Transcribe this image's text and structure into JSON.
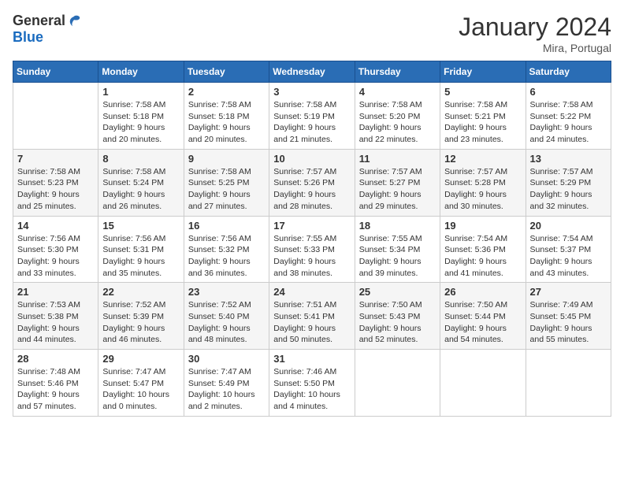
{
  "logo": {
    "general": "General",
    "blue": "Blue"
  },
  "header": {
    "month": "January 2024",
    "location": "Mira, Portugal"
  },
  "weekdays": [
    "Sunday",
    "Monday",
    "Tuesday",
    "Wednesday",
    "Thursday",
    "Friday",
    "Saturday"
  ],
  "weeks": [
    [
      {
        "day": "",
        "info": ""
      },
      {
        "day": "1",
        "info": "Sunrise: 7:58 AM\nSunset: 5:18 PM\nDaylight: 9 hours\nand 20 minutes."
      },
      {
        "day": "2",
        "info": "Sunrise: 7:58 AM\nSunset: 5:18 PM\nDaylight: 9 hours\nand 20 minutes."
      },
      {
        "day": "3",
        "info": "Sunrise: 7:58 AM\nSunset: 5:19 PM\nDaylight: 9 hours\nand 21 minutes."
      },
      {
        "day": "4",
        "info": "Sunrise: 7:58 AM\nSunset: 5:20 PM\nDaylight: 9 hours\nand 22 minutes."
      },
      {
        "day": "5",
        "info": "Sunrise: 7:58 AM\nSunset: 5:21 PM\nDaylight: 9 hours\nand 23 minutes."
      },
      {
        "day": "6",
        "info": "Sunrise: 7:58 AM\nSunset: 5:22 PM\nDaylight: 9 hours\nand 24 minutes."
      }
    ],
    [
      {
        "day": "7",
        "info": "Sunrise: 7:58 AM\nSunset: 5:23 PM\nDaylight: 9 hours\nand 25 minutes."
      },
      {
        "day": "8",
        "info": "Sunrise: 7:58 AM\nSunset: 5:24 PM\nDaylight: 9 hours\nand 26 minutes."
      },
      {
        "day": "9",
        "info": "Sunrise: 7:58 AM\nSunset: 5:25 PM\nDaylight: 9 hours\nand 27 minutes."
      },
      {
        "day": "10",
        "info": "Sunrise: 7:57 AM\nSunset: 5:26 PM\nDaylight: 9 hours\nand 28 minutes."
      },
      {
        "day": "11",
        "info": "Sunrise: 7:57 AM\nSunset: 5:27 PM\nDaylight: 9 hours\nand 29 minutes."
      },
      {
        "day": "12",
        "info": "Sunrise: 7:57 AM\nSunset: 5:28 PM\nDaylight: 9 hours\nand 30 minutes."
      },
      {
        "day": "13",
        "info": "Sunrise: 7:57 AM\nSunset: 5:29 PM\nDaylight: 9 hours\nand 32 minutes."
      }
    ],
    [
      {
        "day": "14",
        "info": "Sunrise: 7:56 AM\nSunset: 5:30 PM\nDaylight: 9 hours\nand 33 minutes."
      },
      {
        "day": "15",
        "info": "Sunrise: 7:56 AM\nSunset: 5:31 PM\nDaylight: 9 hours\nand 35 minutes."
      },
      {
        "day": "16",
        "info": "Sunrise: 7:56 AM\nSunset: 5:32 PM\nDaylight: 9 hours\nand 36 minutes."
      },
      {
        "day": "17",
        "info": "Sunrise: 7:55 AM\nSunset: 5:33 PM\nDaylight: 9 hours\nand 38 minutes."
      },
      {
        "day": "18",
        "info": "Sunrise: 7:55 AM\nSunset: 5:34 PM\nDaylight: 9 hours\nand 39 minutes."
      },
      {
        "day": "19",
        "info": "Sunrise: 7:54 AM\nSunset: 5:36 PM\nDaylight: 9 hours\nand 41 minutes."
      },
      {
        "day": "20",
        "info": "Sunrise: 7:54 AM\nSunset: 5:37 PM\nDaylight: 9 hours\nand 43 minutes."
      }
    ],
    [
      {
        "day": "21",
        "info": "Sunrise: 7:53 AM\nSunset: 5:38 PM\nDaylight: 9 hours\nand 44 minutes."
      },
      {
        "day": "22",
        "info": "Sunrise: 7:52 AM\nSunset: 5:39 PM\nDaylight: 9 hours\nand 46 minutes."
      },
      {
        "day": "23",
        "info": "Sunrise: 7:52 AM\nSunset: 5:40 PM\nDaylight: 9 hours\nand 48 minutes."
      },
      {
        "day": "24",
        "info": "Sunrise: 7:51 AM\nSunset: 5:41 PM\nDaylight: 9 hours\nand 50 minutes."
      },
      {
        "day": "25",
        "info": "Sunrise: 7:50 AM\nSunset: 5:43 PM\nDaylight: 9 hours\nand 52 minutes."
      },
      {
        "day": "26",
        "info": "Sunrise: 7:50 AM\nSunset: 5:44 PM\nDaylight: 9 hours\nand 54 minutes."
      },
      {
        "day": "27",
        "info": "Sunrise: 7:49 AM\nSunset: 5:45 PM\nDaylight: 9 hours\nand 55 minutes."
      }
    ],
    [
      {
        "day": "28",
        "info": "Sunrise: 7:48 AM\nSunset: 5:46 PM\nDaylight: 9 hours\nand 57 minutes."
      },
      {
        "day": "29",
        "info": "Sunrise: 7:47 AM\nSunset: 5:47 PM\nDaylight: 10 hours\nand 0 minutes."
      },
      {
        "day": "30",
        "info": "Sunrise: 7:47 AM\nSunset: 5:49 PM\nDaylight: 10 hours\nand 2 minutes."
      },
      {
        "day": "31",
        "info": "Sunrise: 7:46 AM\nSunset: 5:50 PM\nDaylight: 10 hours\nand 4 minutes."
      },
      {
        "day": "",
        "info": ""
      },
      {
        "day": "",
        "info": ""
      },
      {
        "day": "",
        "info": ""
      }
    ]
  ]
}
